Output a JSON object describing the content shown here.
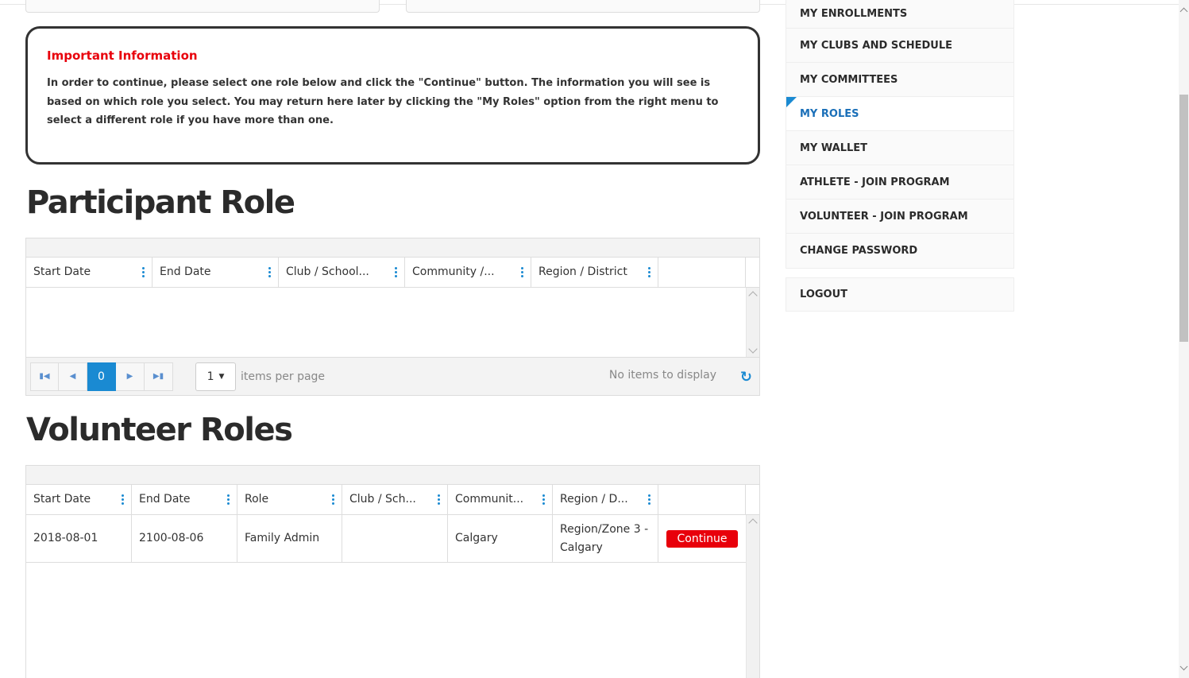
{
  "info": {
    "title": "Important Information",
    "text": "In order to continue, please select one role below and click the \"Continue\" button. The information you will see is based on which role you select. You may return here later by clicking the \"My Roles\" option from the right menu to select a different role if you have more than one."
  },
  "participant": {
    "heading": "Participant Role",
    "columns": [
      "Start Date",
      "End Date",
      "Club / School...",
      "Community /...",
      "Region / District"
    ],
    "pager": {
      "current_page": "0",
      "per_page": "1",
      "per_page_label": "items per page",
      "status": "No items to display",
      "first_icon": "first-page-icon",
      "prev_icon": "prev-page-icon",
      "next_icon": "next-page-icon",
      "last_icon": "last-page-icon",
      "refresh_icon": "refresh-icon"
    }
  },
  "volunteer": {
    "heading": "Volunteer Roles",
    "columns": [
      "Start Date",
      "End Date",
      "Role",
      "Club / Sch...",
      "Communit...",
      "Region / D..."
    ],
    "rows": [
      {
        "start_date": "2018-08-01",
        "end_date": "2100-08-06",
        "role": "Family Admin",
        "club": "",
        "community": "Calgary",
        "region": "Region/Zone 3 - Calgary",
        "action": "Continue"
      }
    ]
  },
  "nav": {
    "items": [
      "MY ENROLLMENTS",
      "MY CLUBS AND SCHEDULE",
      "MY COMMITTEES",
      "MY ROLES",
      "MY WALLET",
      "ATHLETE - JOIN PROGRAM",
      "VOLUNTEER - JOIN PROGRAM",
      "CHANGE PASSWORD"
    ],
    "active_index": 3,
    "logout": "LOGOUT"
  },
  "colors": {
    "accent": "#1a8ad2",
    "alert": "#e8000b",
    "heading": "#2b2b2b"
  }
}
